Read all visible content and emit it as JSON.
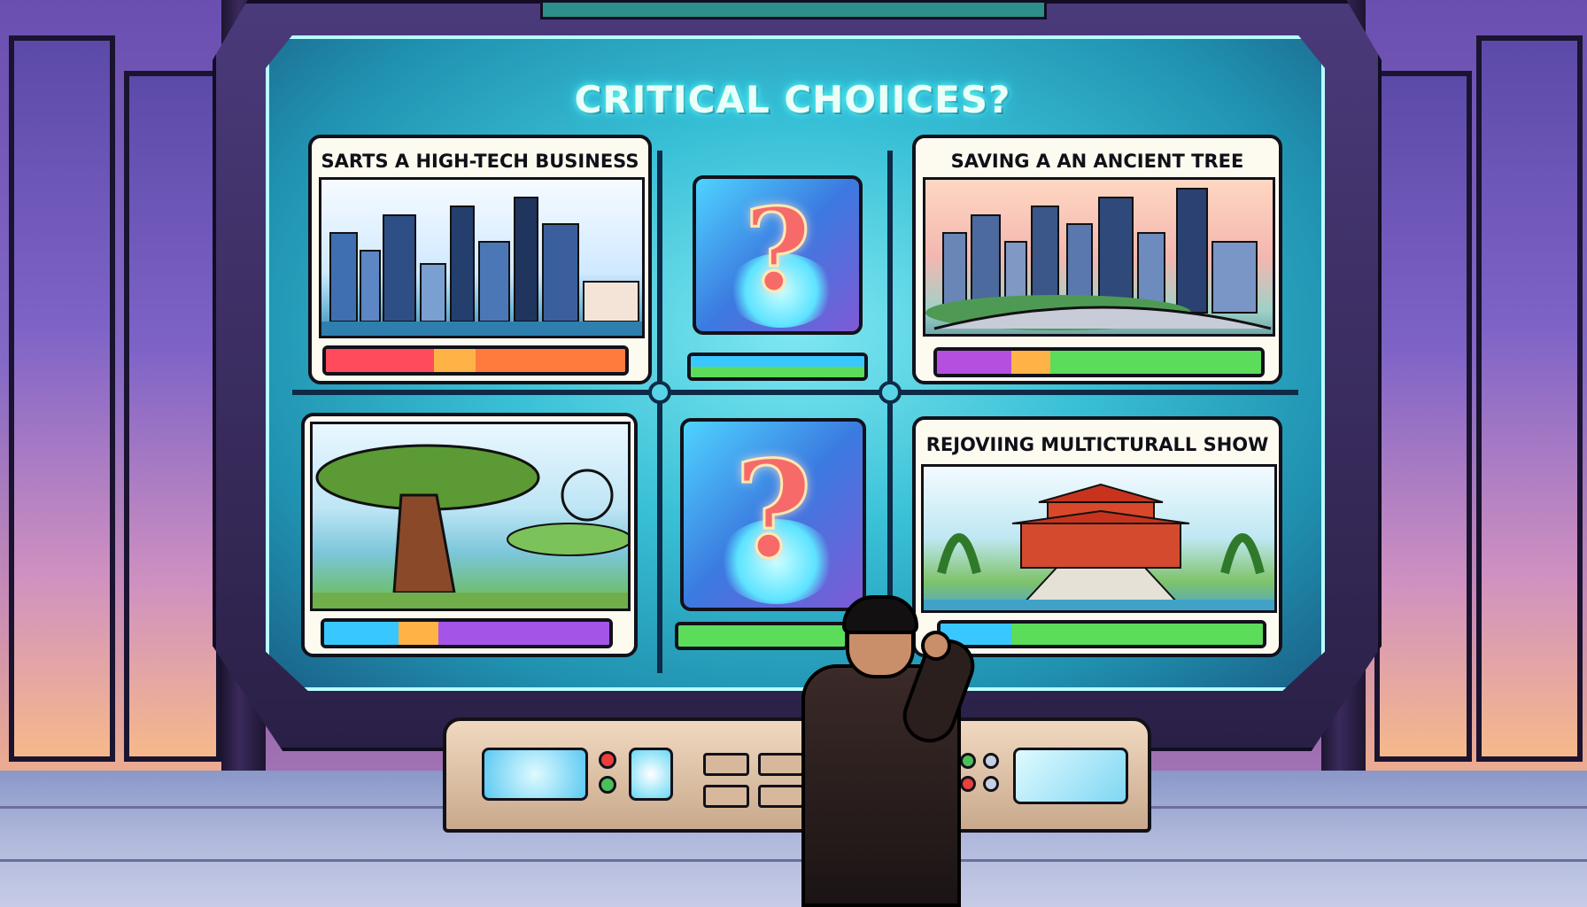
{
  "screen": {
    "title": "CRITICAL CHOIICES?"
  },
  "choices": [
    {
      "label": "SARTS A HIGH-TECH BUSINESS",
      "scene_icon": "city-skyline-icon",
      "bar_colors": [
        "#ff4b5c",
        "#ffb347",
        "#ff7a3d"
      ]
    },
    {
      "label": "",
      "scene_icon": "question-mark-icon",
      "bar_colors": [
        "#38c8ff",
        "#5bdc5b"
      ]
    },
    {
      "label": "SAVING A AN ANCIENT TREE",
      "scene_icon": "city-skyline-icon",
      "bar_colors": [
        "#b54fe0",
        "#ffb347",
        "#5bdc5b"
      ]
    },
    {
      "label": "",
      "scene_icon": "ancient-tree-icon",
      "bar_colors": [
        "#38c8ff",
        "#ffb347",
        "#a455e8"
      ]
    },
    {
      "label": "",
      "scene_icon": "question-mark-icon",
      "bar_colors": [
        "#5bdc5b"
      ]
    },
    {
      "label": "REJOVIING MULTICTURALL SHOW",
      "scene_icon": "temple-icon",
      "bar_colors": [
        "#38c8ff",
        "#5bdc5b",
        "#5bdc5b"
      ]
    }
  ],
  "question_mark": "?",
  "colors": {
    "screen_glow": "#7fe8f2",
    "card_bg": "#fdfaf0",
    "outline": "#12111a"
  }
}
